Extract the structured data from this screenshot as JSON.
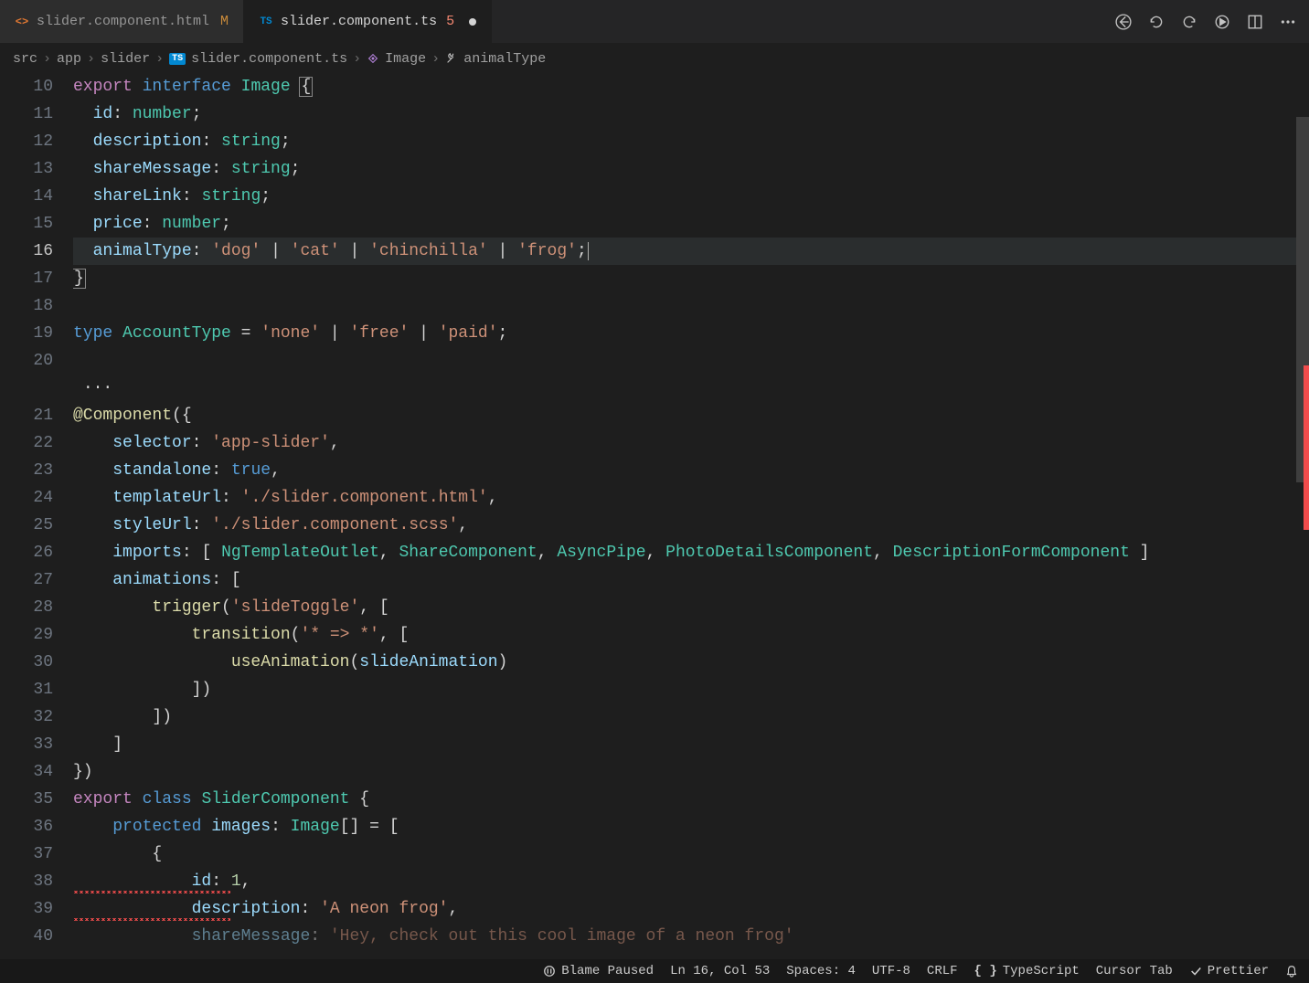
{
  "tabs": [
    {
      "icon": "html",
      "name": "slider.component.html",
      "badge": "M",
      "active": false
    },
    {
      "icon": "ts",
      "name": "slider.component.ts",
      "badge": "5",
      "badgeType": "err",
      "active": true,
      "dirty": true
    }
  ],
  "breadcrumbs": {
    "parts": [
      "src",
      "app",
      "slider"
    ],
    "file": "slider.component.ts",
    "symbols": [
      "Image",
      "animalType"
    ]
  },
  "editor": {
    "lines": [
      {
        "no": 10,
        "tokens": [
          [
            "kw2",
            "export"
          ],
          [
            "sp",
            " "
          ],
          [
            "kw",
            "interface"
          ],
          [
            "sp",
            " "
          ],
          [
            "type",
            "Image"
          ],
          [
            "sp",
            " "
          ],
          [
            "punct brace-hl",
            "{"
          ]
        ]
      },
      {
        "no": 11,
        "indent": 2,
        "tokens": [
          [
            "prop",
            "id"
          ],
          [
            "punct",
            ": "
          ],
          [
            "type",
            "number"
          ],
          [
            "punct",
            ";"
          ]
        ]
      },
      {
        "no": 12,
        "indent": 2,
        "tokens": [
          [
            "prop",
            "description"
          ],
          [
            "punct",
            ": "
          ],
          [
            "type",
            "string"
          ],
          [
            "punct",
            ";"
          ]
        ]
      },
      {
        "no": 13,
        "indent": 2,
        "tokens": [
          [
            "prop",
            "shareMessage"
          ],
          [
            "punct",
            ": "
          ],
          [
            "type",
            "string"
          ],
          [
            "punct",
            ";"
          ]
        ]
      },
      {
        "no": 14,
        "indent": 2,
        "tokens": [
          [
            "prop",
            "shareLink"
          ],
          [
            "punct",
            ": "
          ],
          [
            "type",
            "string"
          ],
          [
            "punct",
            ";"
          ]
        ]
      },
      {
        "no": 15,
        "indent": 2,
        "tokens": [
          [
            "prop",
            "price"
          ],
          [
            "punct",
            ": "
          ],
          [
            "type",
            "number"
          ],
          [
            "punct",
            ";"
          ]
        ]
      },
      {
        "no": 16,
        "indent": 2,
        "active": true,
        "tokens": [
          [
            "prop",
            "animalType"
          ],
          [
            "punct",
            ": "
          ],
          [
            "str",
            "'dog'"
          ],
          [
            "op",
            " | "
          ],
          [
            "str",
            "'cat'"
          ],
          [
            "op",
            " | "
          ],
          [
            "str",
            "'chinchilla'"
          ],
          [
            "op",
            " | "
          ],
          [
            "str",
            "'frog'"
          ],
          [
            "punct",
            ";"
          ]
        ],
        "cursorAfter": true
      },
      {
        "no": 17,
        "tokens": [
          [
            "punct brace-hl",
            "}"
          ]
        ]
      },
      {
        "no": 18,
        "tokens": []
      },
      {
        "no": 19,
        "tokens": [
          [
            "kw",
            "type"
          ],
          [
            "sp",
            " "
          ],
          [
            "type",
            "AccountType"
          ],
          [
            "op",
            " = "
          ],
          [
            "str",
            "'none'"
          ],
          [
            "op",
            " | "
          ],
          [
            "str",
            "'free'"
          ],
          [
            "op",
            " | "
          ],
          [
            "str",
            "'paid'"
          ],
          [
            "punct",
            ";"
          ]
        ]
      },
      {
        "no": 20,
        "tokens": []
      },
      {
        "no": null,
        "indent": 1,
        "tokens": [
          [
            "punct",
            "···"
          ]
        ]
      },
      {
        "no": 21,
        "tokens": [
          [
            "decor",
            "@Component"
          ],
          [
            "punct",
            "({"
          ]
        ]
      },
      {
        "no": 22,
        "indent": 4,
        "tokens": [
          [
            "prop",
            "selector"
          ],
          [
            "punct",
            ": "
          ],
          [
            "str",
            "'app-slider'"
          ],
          [
            "punct",
            ","
          ]
        ]
      },
      {
        "no": 23,
        "indent": 4,
        "tokens": [
          [
            "prop",
            "standalone"
          ],
          [
            "punct",
            ": "
          ],
          [
            "kw",
            "true"
          ],
          [
            "punct",
            ","
          ]
        ]
      },
      {
        "no": 24,
        "indent": 4,
        "tokens": [
          [
            "prop",
            "templateUrl"
          ],
          [
            "punct",
            ": "
          ],
          [
            "str",
            "'./slider.component.html'"
          ],
          [
            "punct",
            ","
          ]
        ]
      },
      {
        "no": 25,
        "indent": 4,
        "tokens": [
          [
            "prop",
            "styleUrl"
          ],
          [
            "punct",
            ": "
          ],
          [
            "str",
            "'./slider.component.scss'"
          ],
          [
            "punct",
            ","
          ]
        ]
      },
      {
        "no": 26,
        "indent": 4,
        "tokens": [
          [
            "prop",
            "imports"
          ],
          [
            "punct",
            ": [ "
          ],
          [
            "type",
            "NgTemplateOutlet"
          ],
          [
            "punct",
            ", "
          ],
          [
            "type",
            "ShareComponent"
          ],
          [
            "punct",
            ", "
          ],
          [
            "type",
            "AsyncPipe"
          ],
          [
            "punct",
            ", "
          ],
          [
            "type",
            "PhotoDetailsComponent"
          ],
          [
            "punct",
            ", "
          ],
          [
            "type",
            "DescriptionFormComponent"
          ],
          [
            "punct",
            " ]"
          ]
        ]
      },
      {
        "no": 27,
        "indent": 4,
        "tokens": [
          [
            "prop",
            "animations"
          ],
          [
            "punct",
            ": ["
          ]
        ]
      },
      {
        "no": 28,
        "indent": 8,
        "tokens": [
          [
            "func",
            "trigger"
          ],
          [
            "punct",
            "("
          ],
          [
            "str",
            "'slideToggle'"
          ],
          [
            "punct",
            ", ["
          ]
        ]
      },
      {
        "no": 29,
        "indent": 12,
        "tokens": [
          [
            "func",
            "transition"
          ],
          [
            "punct",
            "("
          ],
          [
            "str",
            "'* => *'"
          ],
          [
            "punct",
            ", ["
          ]
        ]
      },
      {
        "no": 30,
        "indent": 16,
        "tokens": [
          [
            "func",
            "useAnimation"
          ],
          [
            "punct",
            "("
          ],
          [
            "prop",
            "slideAnimation"
          ],
          [
            "punct",
            ")"
          ]
        ]
      },
      {
        "no": 31,
        "indent": 12,
        "tokens": [
          [
            "punct",
            "])"
          ]
        ]
      },
      {
        "no": 32,
        "indent": 8,
        "tokens": [
          [
            "punct",
            "])"
          ]
        ]
      },
      {
        "no": 33,
        "indent": 4,
        "tokens": [
          [
            "punct",
            "]"
          ]
        ]
      },
      {
        "no": 34,
        "tokens": [
          [
            "punct",
            "})"
          ]
        ]
      },
      {
        "no": 35,
        "tokens": [
          [
            "kw2",
            "export"
          ],
          [
            "sp",
            " "
          ],
          [
            "kw",
            "class"
          ],
          [
            "sp",
            " "
          ],
          [
            "type",
            "SliderComponent"
          ],
          [
            "sp",
            " "
          ],
          [
            "punct",
            "{"
          ]
        ]
      },
      {
        "no": 36,
        "indent": 4,
        "tokens": [
          [
            "kw",
            "protected"
          ],
          [
            "sp",
            " "
          ],
          [
            "prop",
            "images"
          ],
          [
            "punct",
            ": "
          ],
          [
            "type",
            "Image"
          ],
          [
            "punct",
            "[] = ["
          ]
        ]
      },
      {
        "no": 37,
        "indent": 8,
        "tokens": [
          [
            "punct",
            "{"
          ]
        ]
      },
      {
        "no": 38,
        "indent": 12,
        "squiggle": true,
        "tokens": [
          [
            "prop",
            "id"
          ],
          [
            "punct",
            ": "
          ],
          [
            "num",
            "1"
          ],
          [
            "punct",
            ","
          ]
        ]
      },
      {
        "no": 39,
        "indent": 12,
        "squiggle": true,
        "tokens": [
          [
            "prop",
            "description"
          ],
          [
            "punct",
            ": "
          ],
          [
            "str",
            "'A neon frog'"
          ],
          [
            "punct",
            ","
          ]
        ]
      },
      {
        "no": 40,
        "indent": 12,
        "faded": true,
        "tokens": [
          [
            "prop",
            "shareMessage"
          ],
          [
            "punct",
            ": "
          ],
          [
            "str",
            "'Hey, check out this cool image of a neon frog'"
          ]
        ]
      }
    ]
  },
  "statusbar": {
    "blame": "Blame Paused",
    "pos": "Ln 16, Col 53",
    "spaces": "Spaces: 4",
    "encoding": "UTF-8",
    "eol": "CRLF",
    "lang": "TypeScript",
    "cursor": "Cursor Tab",
    "prettier": "Prettier"
  }
}
